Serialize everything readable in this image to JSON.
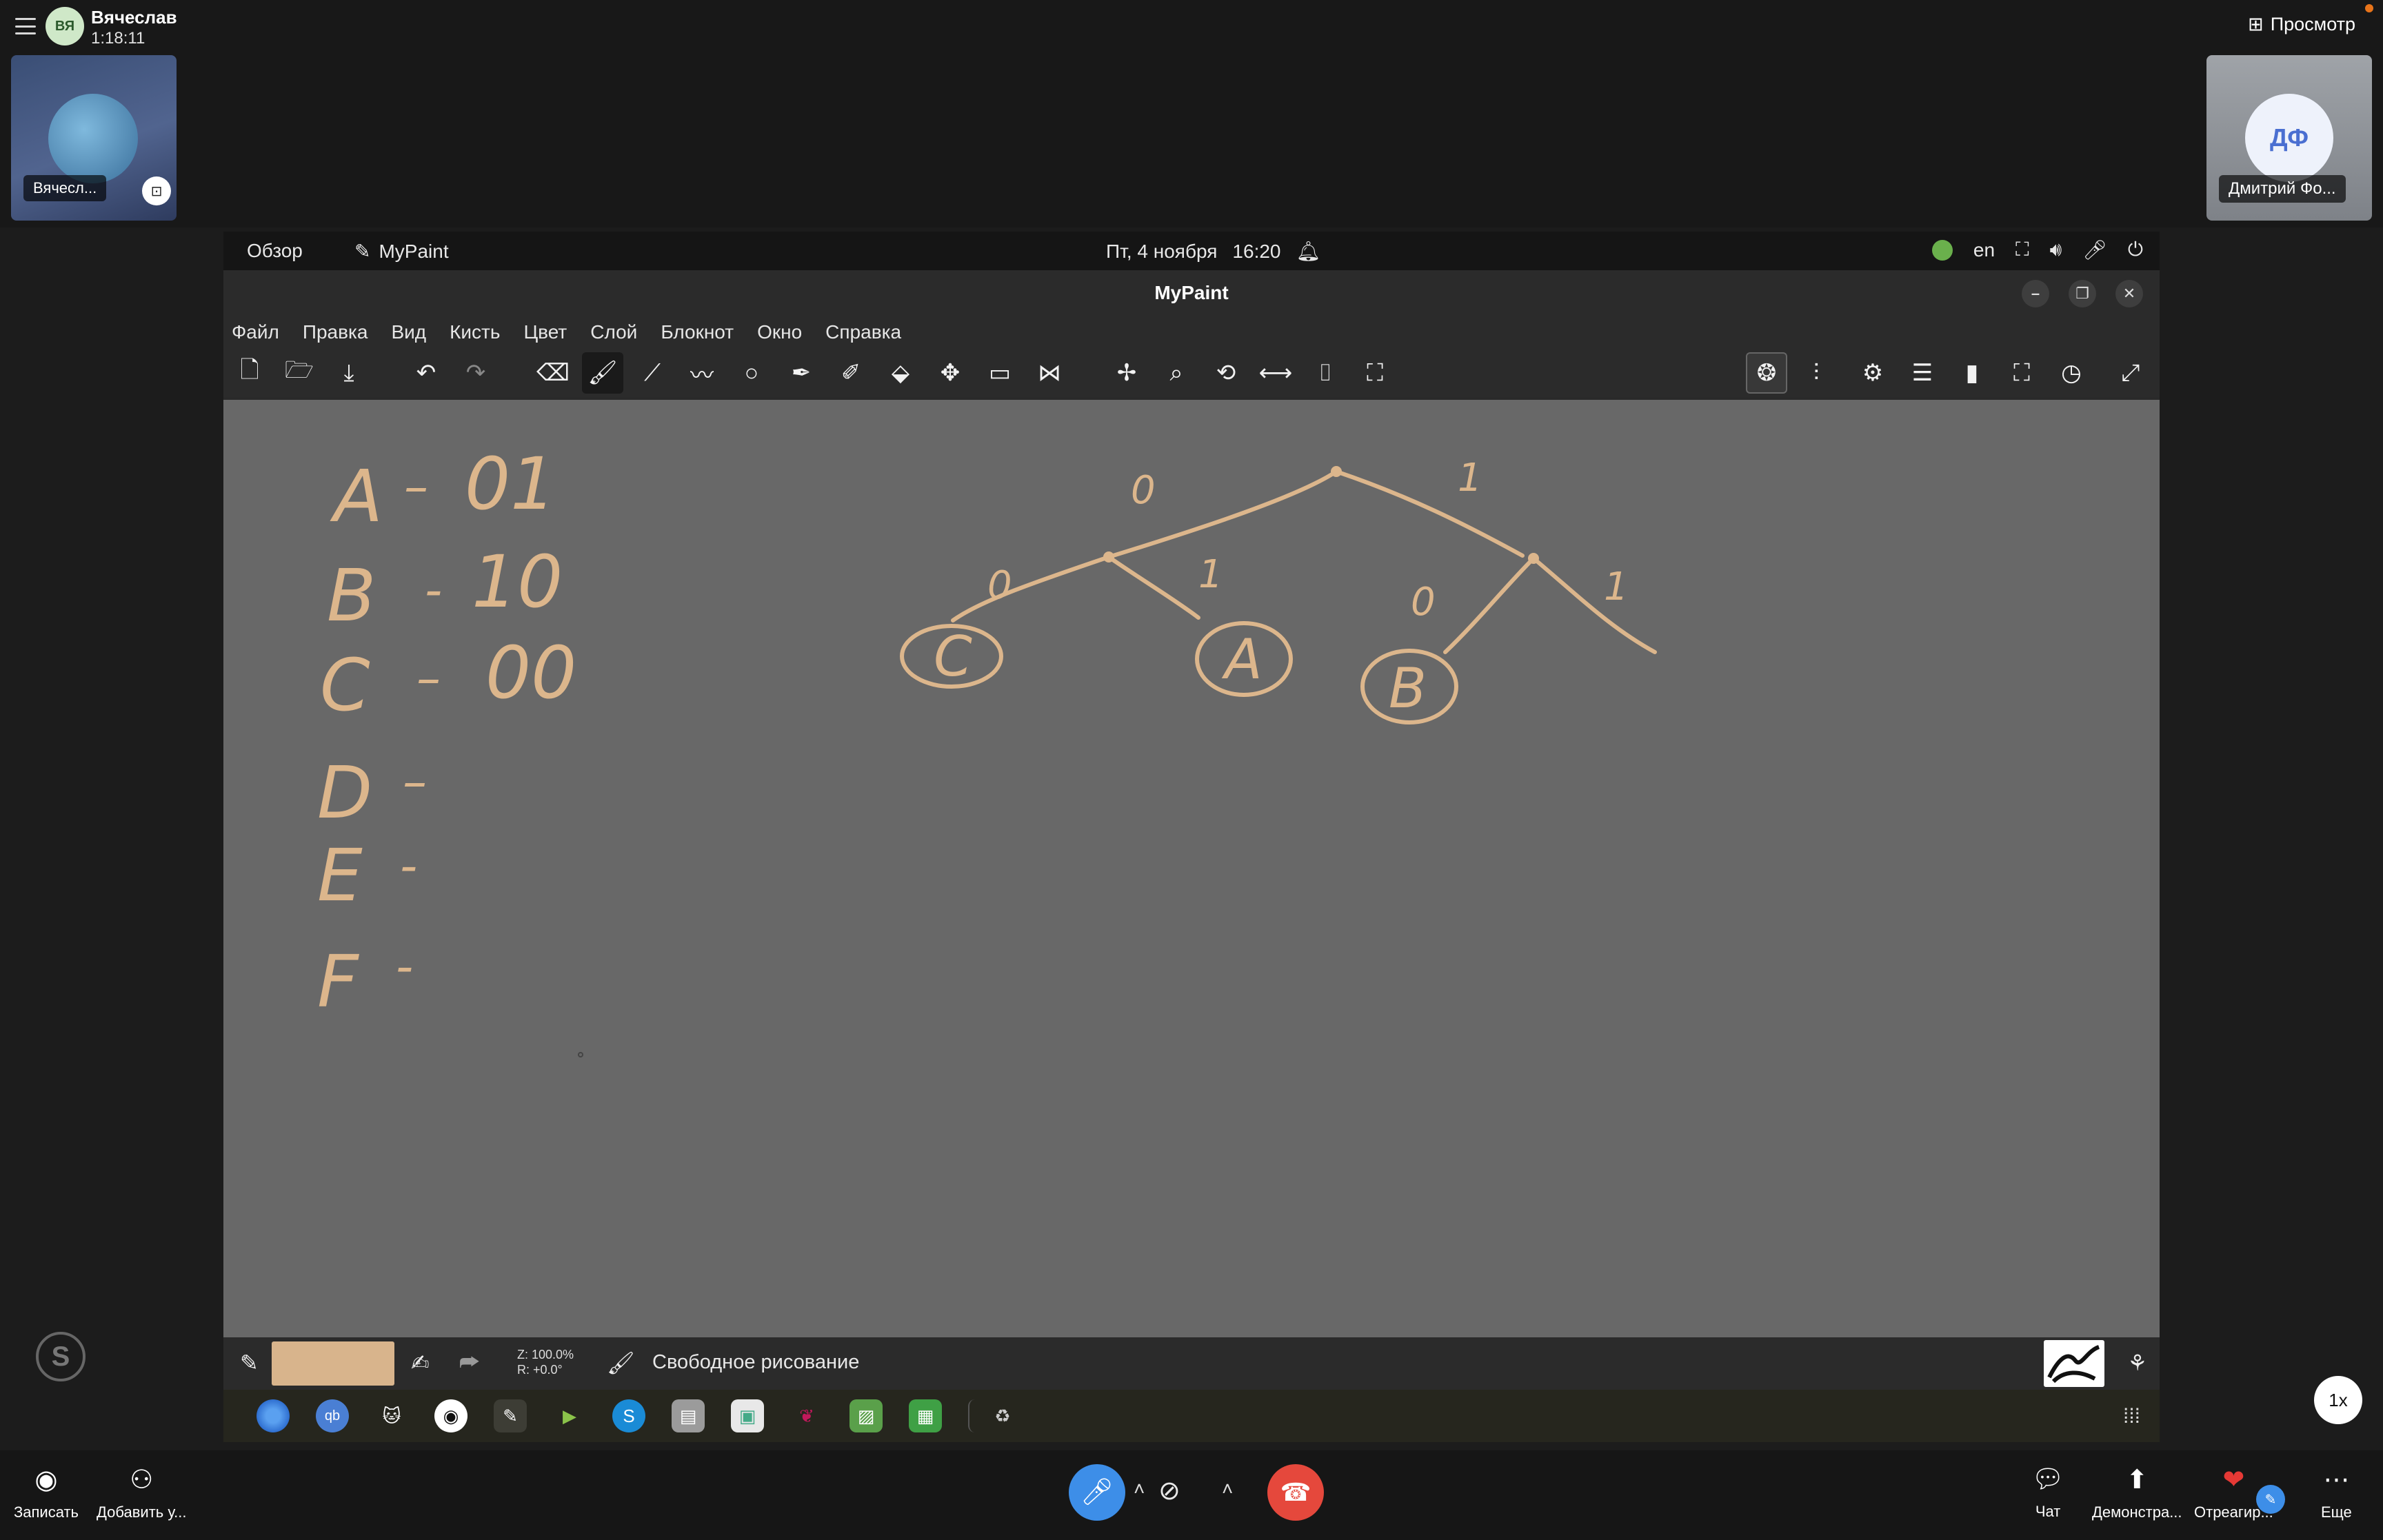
{
  "call": {
    "presenter_initials": "ВЯ",
    "presenter_name": "Вячеслав",
    "duration": "1:18:11",
    "self_tile_label": "Вячесл...",
    "preview_label": "Просмотр",
    "remote_initials": "ДФ",
    "remote_label": "Дмитрий Фо..."
  },
  "desktop": {
    "overview": "Обзор",
    "active_app": "MyPaint",
    "date": "Пт, 4 ноября",
    "time": "16:20",
    "lang": "en"
  },
  "app": {
    "title": "MyPaint",
    "menu": [
      "Файл",
      "Правка",
      "Вид",
      "Кисть",
      "Цвет",
      "Слой",
      "Блокнот",
      "Окно",
      "Справка"
    ],
    "status_zoom": "Z: 100.0%",
    "status_rotation": "R: +0.0°",
    "status_mode": "Свободное рисование",
    "brush_color": "#d8b48c",
    "canvas_color": "#686868",
    "stroke_color": "#dcb68c"
  },
  "drawing": {
    "codes": [
      {
        "letter": "A",
        "dash": "–",
        "code": "01"
      },
      {
        "letter": "B",
        "dash": "-",
        "code": "10"
      },
      {
        "letter": "C",
        "dash": "–",
        "code": "00"
      },
      {
        "letter": "D",
        "dash": "–",
        "code": ""
      },
      {
        "letter": "E",
        "dash": "-",
        "code": ""
      },
      {
        "letter": "F",
        "dash": "-",
        "code": ""
      }
    ],
    "tree": {
      "root_edges": [
        "0",
        "1"
      ],
      "left_edges": [
        "0",
        "1"
      ],
      "right_edges": [
        "0",
        "1"
      ],
      "leaves": [
        "C",
        "A",
        "B"
      ]
    }
  },
  "callbar": {
    "record": "Записать",
    "add_user": "Добавить у...",
    "chat": "Чат",
    "share": "Демонстра...",
    "react": "Отреагир...",
    "more": "Еще",
    "speed": "1x",
    "logo": "S"
  }
}
